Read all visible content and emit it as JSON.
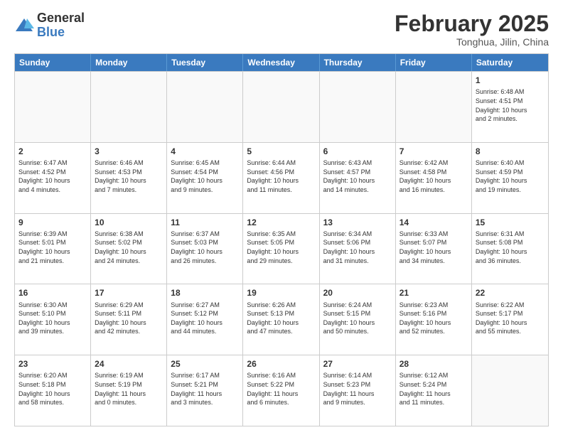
{
  "logo": {
    "general": "General",
    "blue": "Blue"
  },
  "header": {
    "month_year": "February 2025",
    "location": "Tonghua, Jilin, China"
  },
  "weekdays": [
    "Sunday",
    "Monday",
    "Tuesday",
    "Wednesday",
    "Thursday",
    "Friday",
    "Saturday"
  ],
  "weeks": [
    [
      {
        "day": "",
        "info": ""
      },
      {
        "day": "",
        "info": ""
      },
      {
        "day": "",
        "info": ""
      },
      {
        "day": "",
        "info": ""
      },
      {
        "day": "",
        "info": ""
      },
      {
        "day": "",
        "info": ""
      },
      {
        "day": "1",
        "info": "Sunrise: 6:48 AM\nSunset: 4:51 PM\nDaylight: 10 hours\nand 2 minutes."
      }
    ],
    [
      {
        "day": "2",
        "info": "Sunrise: 6:47 AM\nSunset: 4:52 PM\nDaylight: 10 hours\nand 4 minutes."
      },
      {
        "day": "3",
        "info": "Sunrise: 6:46 AM\nSunset: 4:53 PM\nDaylight: 10 hours\nand 7 minutes."
      },
      {
        "day": "4",
        "info": "Sunrise: 6:45 AM\nSunset: 4:54 PM\nDaylight: 10 hours\nand 9 minutes."
      },
      {
        "day": "5",
        "info": "Sunrise: 6:44 AM\nSunset: 4:56 PM\nDaylight: 10 hours\nand 11 minutes."
      },
      {
        "day": "6",
        "info": "Sunrise: 6:43 AM\nSunset: 4:57 PM\nDaylight: 10 hours\nand 14 minutes."
      },
      {
        "day": "7",
        "info": "Sunrise: 6:42 AM\nSunset: 4:58 PM\nDaylight: 10 hours\nand 16 minutes."
      },
      {
        "day": "8",
        "info": "Sunrise: 6:40 AM\nSunset: 4:59 PM\nDaylight: 10 hours\nand 19 minutes."
      }
    ],
    [
      {
        "day": "9",
        "info": "Sunrise: 6:39 AM\nSunset: 5:01 PM\nDaylight: 10 hours\nand 21 minutes."
      },
      {
        "day": "10",
        "info": "Sunrise: 6:38 AM\nSunset: 5:02 PM\nDaylight: 10 hours\nand 24 minutes."
      },
      {
        "day": "11",
        "info": "Sunrise: 6:37 AM\nSunset: 5:03 PM\nDaylight: 10 hours\nand 26 minutes."
      },
      {
        "day": "12",
        "info": "Sunrise: 6:35 AM\nSunset: 5:05 PM\nDaylight: 10 hours\nand 29 minutes."
      },
      {
        "day": "13",
        "info": "Sunrise: 6:34 AM\nSunset: 5:06 PM\nDaylight: 10 hours\nand 31 minutes."
      },
      {
        "day": "14",
        "info": "Sunrise: 6:33 AM\nSunset: 5:07 PM\nDaylight: 10 hours\nand 34 minutes."
      },
      {
        "day": "15",
        "info": "Sunrise: 6:31 AM\nSunset: 5:08 PM\nDaylight: 10 hours\nand 36 minutes."
      }
    ],
    [
      {
        "day": "16",
        "info": "Sunrise: 6:30 AM\nSunset: 5:10 PM\nDaylight: 10 hours\nand 39 minutes."
      },
      {
        "day": "17",
        "info": "Sunrise: 6:29 AM\nSunset: 5:11 PM\nDaylight: 10 hours\nand 42 minutes."
      },
      {
        "day": "18",
        "info": "Sunrise: 6:27 AM\nSunset: 5:12 PM\nDaylight: 10 hours\nand 44 minutes."
      },
      {
        "day": "19",
        "info": "Sunrise: 6:26 AM\nSunset: 5:13 PM\nDaylight: 10 hours\nand 47 minutes."
      },
      {
        "day": "20",
        "info": "Sunrise: 6:24 AM\nSunset: 5:15 PM\nDaylight: 10 hours\nand 50 minutes."
      },
      {
        "day": "21",
        "info": "Sunrise: 6:23 AM\nSunset: 5:16 PM\nDaylight: 10 hours\nand 52 minutes."
      },
      {
        "day": "22",
        "info": "Sunrise: 6:22 AM\nSunset: 5:17 PM\nDaylight: 10 hours\nand 55 minutes."
      }
    ],
    [
      {
        "day": "23",
        "info": "Sunrise: 6:20 AM\nSunset: 5:18 PM\nDaylight: 10 hours\nand 58 minutes."
      },
      {
        "day": "24",
        "info": "Sunrise: 6:19 AM\nSunset: 5:19 PM\nDaylight: 11 hours\nand 0 minutes."
      },
      {
        "day": "25",
        "info": "Sunrise: 6:17 AM\nSunset: 5:21 PM\nDaylight: 11 hours\nand 3 minutes."
      },
      {
        "day": "26",
        "info": "Sunrise: 6:16 AM\nSunset: 5:22 PM\nDaylight: 11 hours\nand 6 minutes."
      },
      {
        "day": "27",
        "info": "Sunrise: 6:14 AM\nSunset: 5:23 PM\nDaylight: 11 hours\nand 9 minutes."
      },
      {
        "day": "28",
        "info": "Sunrise: 6:12 AM\nSunset: 5:24 PM\nDaylight: 11 hours\nand 11 minutes."
      },
      {
        "day": "",
        "info": ""
      }
    ]
  ]
}
